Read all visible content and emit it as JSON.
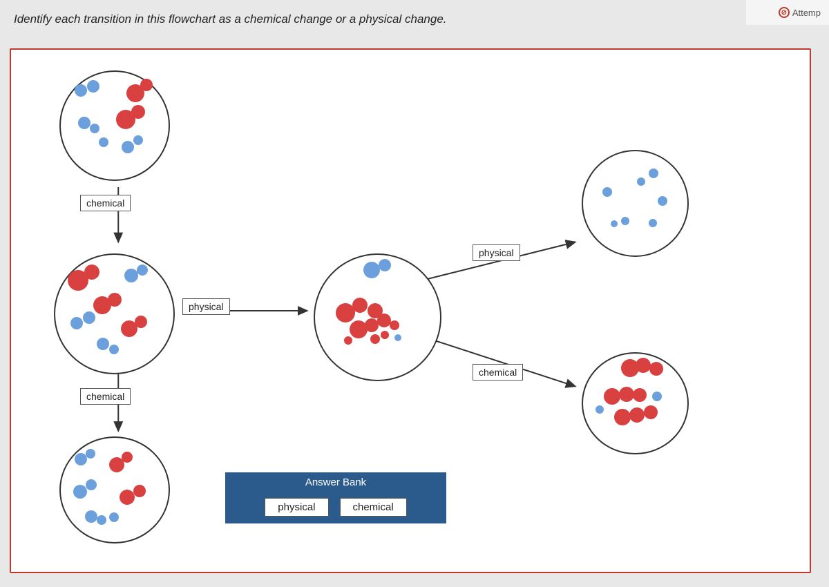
{
  "page": {
    "question": "Identify each transition in this flowchart as a chemical change or a physical change.",
    "attempt_label": "Attemp"
  },
  "labels": {
    "chemical1": "chemical",
    "chemical2": "chemical",
    "chemical3": "chemical",
    "physical1": "physical",
    "physical2": "physical"
  },
  "answer_bank": {
    "header": "Answer Bank",
    "options": [
      "physical",
      "chemical"
    ]
  },
  "circles": {
    "top_left": "Top-left molecule circle (mixed red/blue clusters)",
    "mid_left": "Middle-left molecule circle (larger clusters)",
    "bot_left": "Bottom-left molecule circle (scattered pairs)",
    "center": "Center molecule circle (central hub)",
    "top_right": "Top-right molecule circle (single atoms)",
    "bot_right": "Bottom-right molecule circle (red clusters)"
  }
}
